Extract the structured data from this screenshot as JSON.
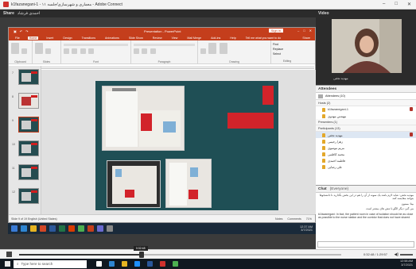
{
  "window": {
    "title": "k1fazanegani-1 - معماری و شهرسازی/جلسه ۱۱ - Adobe Connect",
    "controls": [
      "–",
      "□",
      "✕"
    ]
  },
  "share_pod": {
    "title": "Share",
    "subtitle": "احمدی فرشاد"
  },
  "powerpoint": {
    "title": "Presentation - PowerPoint",
    "sign_in": "Sign in",
    "tell_me": "Tell me what you want to do",
    "share": "Share",
    "tabs": [
      "File",
      "Home",
      "Insert",
      "Design",
      "Transitions",
      "Animations",
      "Slide Show",
      "Review",
      "View",
      "Mail Merge",
      "Add-ins",
      "Help"
    ],
    "active_tab": "Home",
    "ribbon_groups": [
      "Clipboard",
      "Slides",
      "Font",
      "Paragraph",
      "Drawing",
      "Editing"
    ],
    "ribbon_right": [
      "Find",
      "Replace",
      "Select"
    ],
    "slide_numbers": [
      "7",
      "8",
      "9",
      "10",
      "11",
      "12"
    ],
    "status_left": "Slide 9 of 19    English (United States)",
    "status_right": [
      "Notes",
      "Comments",
      "71%"
    ]
  },
  "inner_taskbar": {
    "time": "12:37 AM",
    "date": "3/7/2021"
  },
  "video_pod": {
    "title": "Video",
    "speaker_label": "مهدیه نجفی"
  },
  "attendees_pod": {
    "title": "Attendees",
    "view_label": "Attendees (10)",
    "groups": [
      {
        "label": "Hosts (2)",
        "members": [
          "k1fazanegani-1",
          "مهندس مهدوی"
        ]
      },
      {
        "label": "Presenters (1)",
        "members": []
      },
      {
        "label": "Participants (13)",
        "members": [
          "مهدیه نجفی",
          "زهرا رحیمی",
          "مریم موسوی",
          "محمد کاظمی",
          "فاطمه احمدی",
          "علی رضایی"
        ]
      }
    ]
  },
  "chat_pod": {
    "title": "Chat",
    "subtitle": "(Everyone)",
    "messages": [
      "مهدیه نجفی: شاید لازم باشد یک نمونه از آن را هم در این بخش بگذارید تا دانشجوها بتوانند مقایسه کنند",
      "بیتا: ممنون",
      "می گیر: دیگر الگو با تنش های بیشتر است",
      "k1fazanegani: In fact, the patient room in case of isolation should be as close as possible to the nurse station and the corridor that does not have shared"
    ]
  },
  "player": {
    "time": "0:32:48 / 1:29:57",
    "tooltip": "0:32:48",
    "progress": 0.38
  },
  "taskbar": {
    "search_placeholder": "Type here to search",
    "time": "12:58 AM",
    "date": "3/7/2021"
  },
  "colors": {
    "ppt_accent": "#c43e1c",
    "slide_bg": "#1f4f55",
    "slide_red": "#d2232a"
  }
}
